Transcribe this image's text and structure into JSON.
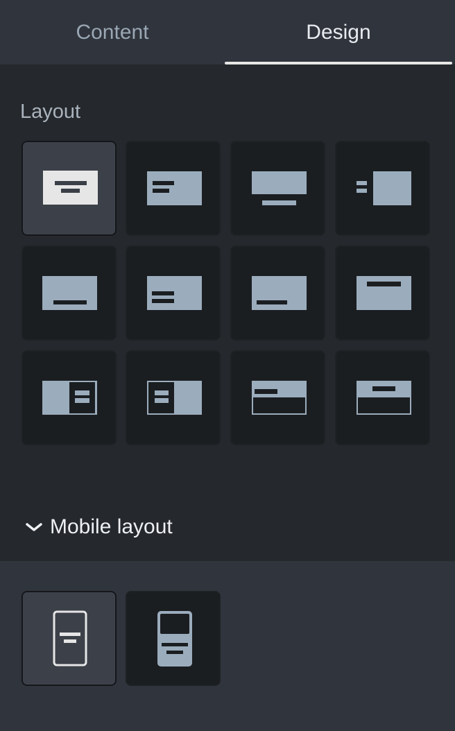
{
  "tabs": [
    {
      "label": "Content",
      "active": false
    },
    {
      "label": "Design",
      "active": true
    }
  ],
  "layout_section": {
    "title": "Layout",
    "options": [
      {
        "icon": "layout-centered-icon",
        "selected": true
      },
      {
        "icon": "layout-text-left-icon",
        "selected": false
      },
      {
        "icon": "layout-image-top-caption-below-icon",
        "selected": false
      },
      {
        "icon": "layout-text-left-image-right-icon",
        "selected": false
      },
      {
        "icon": "layout-text-bottom-left-icon",
        "selected": false
      },
      {
        "icon": "layout-text-middle-left-icon",
        "selected": false
      },
      {
        "icon": "layout-text-bottom-left-offset-icon",
        "selected": false
      },
      {
        "icon": "layout-text-top-center-icon",
        "selected": false
      },
      {
        "icon": "layout-card-right-icon",
        "selected": false
      },
      {
        "icon": "layout-card-left-icon",
        "selected": false
      },
      {
        "icon": "layout-split-top-left-label-icon",
        "selected": false
      },
      {
        "icon": "layout-split-top-center-label-icon",
        "selected": false
      }
    ]
  },
  "mobile_section": {
    "title": "Mobile layout",
    "expanded": true,
    "options": [
      {
        "icon": "mobile-text-only-icon",
        "selected": true
      },
      {
        "icon": "mobile-image-above-text-icon",
        "selected": false
      }
    ]
  },
  "colors": {
    "accent_underline": "#e6e6e6",
    "tile_bg": "#1b1e21",
    "tile_selected_bg": "#3c4049",
    "icon_fill": "#9badbd"
  }
}
